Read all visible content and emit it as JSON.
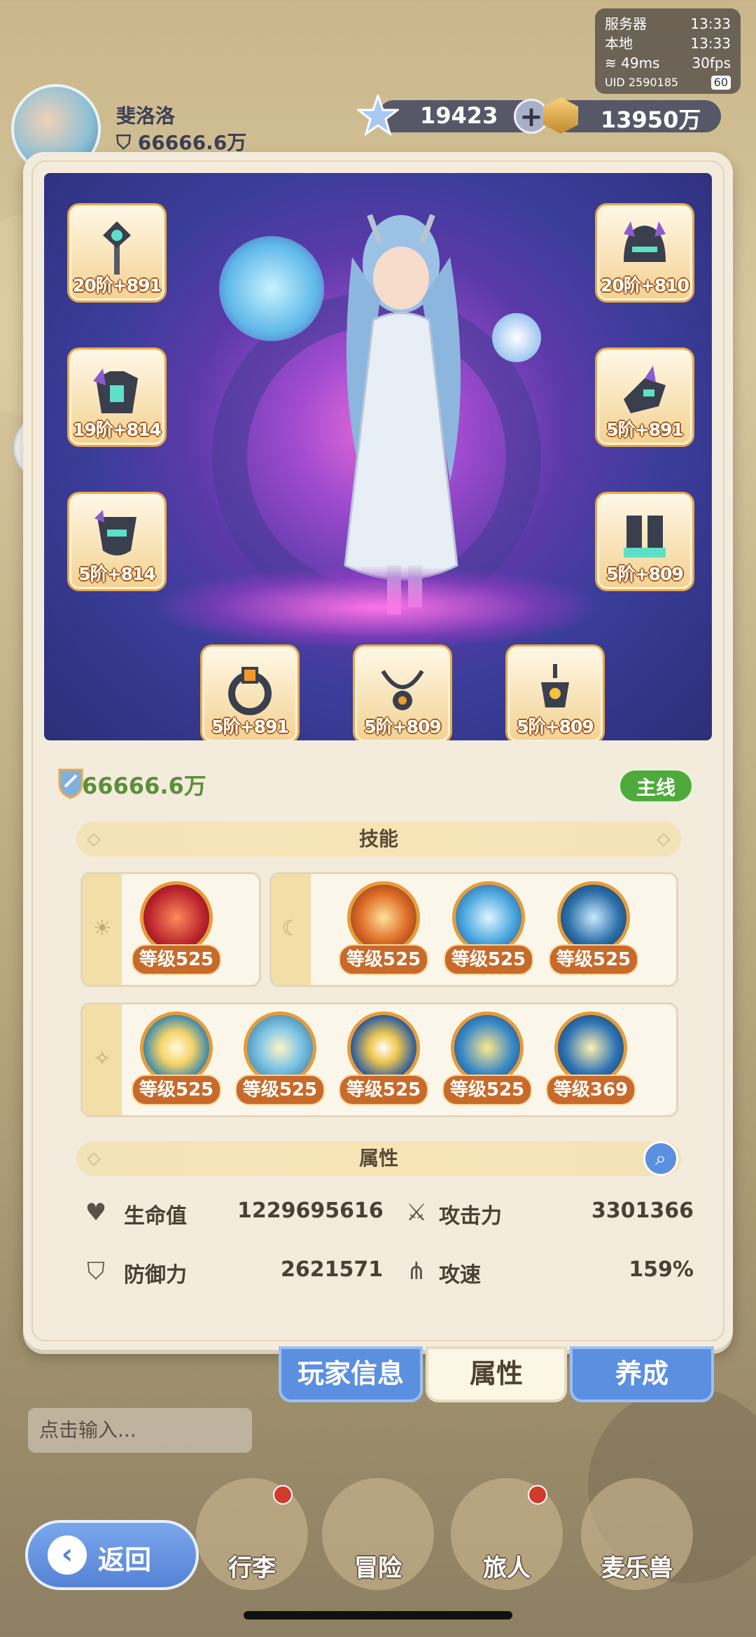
{
  "status": {
    "server_label": "服务器",
    "server_time": "13:33",
    "local_label": "本地",
    "local_time": "13:33",
    "ping": "49ms",
    "fps": "30fps",
    "uid": "UID 2590185",
    "battery": "60"
  },
  "player": {
    "name": "斐洛洛",
    "power": "66666.6万"
  },
  "currency": {
    "gems": "19423",
    "gold": "13950万"
  },
  "equipment": [
    {
      "label": "20阶+891",
      "icon": "staff-icon"
    },
    {
      "label": "20阶+810",
      "icon": "helmet-icon"
    },
    {
      "label": "19阶+814",
      "icon": "armor-icon"
    },
    {
      "label": "5阶+891",
      "icon": "gauntlet-icon"
    },
    {
      "label": "5阶+814",
      "icon": "belt-icon"
    },
    {
      "label": "5阶+809",
      "icon": "boots-icon"
    },
    {
      "label": "5阶+891",
      "icon": "ring-icon"
    },
    {
      "label": "5阶+809",
      "icon": "necklace-icon"
    },
    {
      "label": "5阶+809",
      "icon": "amulet-icon"
    }
  ],
  "combat_power": "66666.6万",
  "mainline_badge": "主线",
  "skills_title": "技能",
  "skill_row1_left": [
    {
      "level": "等级525"
    }
  ],
  "skill_row1_right": [
    {
      "level": "等级525"
    },
    {
      "level": "等级525"
    },
    {
      "level": "等级525"
    }
  ],
  "skill_row2": [
    {
      "level": "等级525"
    },
    {
      "level": "等级525"
    },
    {
      "level": "等级525"
    },
    {
      "level": "等级525"
    },
    {
      "level": "等级369"
    }
  ],
  "attributes_title": "属性",
  "attributes": {
    "hp_label": "生命值",
    "hp_value": "1229695616",
    "atk_label": "攻击力",
    "atk_value": "3301366",
    "def_label": "防御力",
    "def_value": "2621571",
    "spd_label": "攻速",
    "spd_value": "159%"
  },
  "tabs": {
    "info": "玩家信息",
    "attr": "属性",
    "grow": "养成"
  },
  "chat_placeholder": "点击输入...",
  "nav": {
    "back": "返回",
    "bag": "行李",
    "adventure": "冒险",
    "traveler": "旅人",
    "pet": "麦乐兽"
  },
  "colors": {
    "panel": "#f3ecdc",
    "accent_blue": "#5b8fe0",
    "level_badge": "#c76a2a",
    "power_green": "#5b8f3a"
  }
}
